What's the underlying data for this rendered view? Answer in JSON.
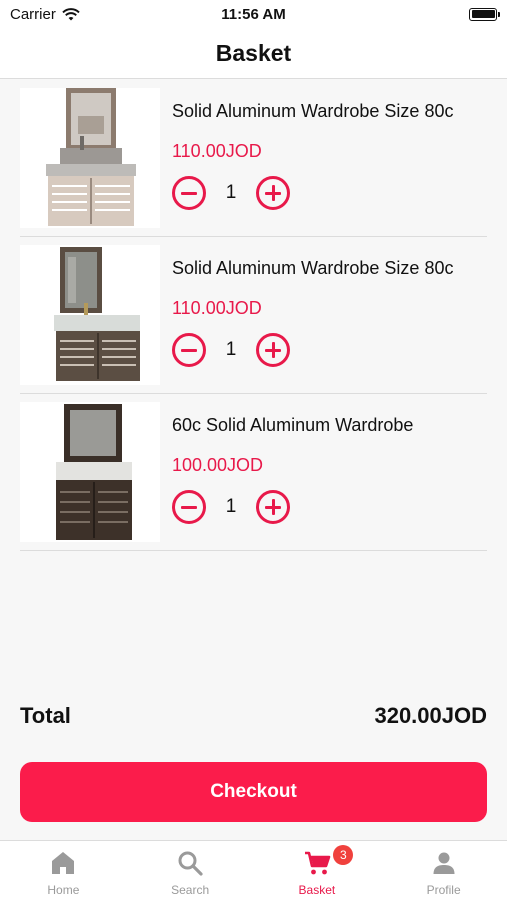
{
  "status_bar": {
    "carrier": "Carrier",
    "time": "11:56 AM"
  },
  "nav": {
    "title": "Basket"
  },
  "basket": {
    "items": [
      {
        "name": "Solid Aluminum Wardrobe Size 80c",
        "price": "110.00JOD",
        "quantity": "1",
        "image": "bathroom-vanity-light"
      },
      {
        "name": "Solid Aluminum Wardrobe Size 80c",
        "price": "110.00JOD",
        "quantity": "1",
        "image": "bathroom-vanity-dark-mirror"
      },
      {
        "name": "60c Solid Aluminum Wardrobe",
        "price": "100.00JOD",
        "quantity": "1",
        "image": "bathroom-vanity-dark"
      }
    ]
  },
  "summary": {
    "total_label": "Total",
    "total_value": "320.00JOD"
  },
  "checkout": {
    "label": "Checkout"
  },
  "tab_bar": {
    "tabs": [
      {
        "label": "Home",
        "icon": "home-icon"
      },
      {
        "label": "Search",
        "icon": "search-icon"
      },
      {
        "label": "Basket",
        "icon": "cart-icon",
        "badge": "3",
        "active": true
      },
      {
        "label": "Profile",
        "icon": "person-icon"
      }
    ]
  },
  "colors": {
    "accent": "#e8194a",
    "checkout_bg": "#fb1c4b",
    "badge_bg": "#f0413d",
    "inactive_tab": "#9a9a9a"
  }
}
